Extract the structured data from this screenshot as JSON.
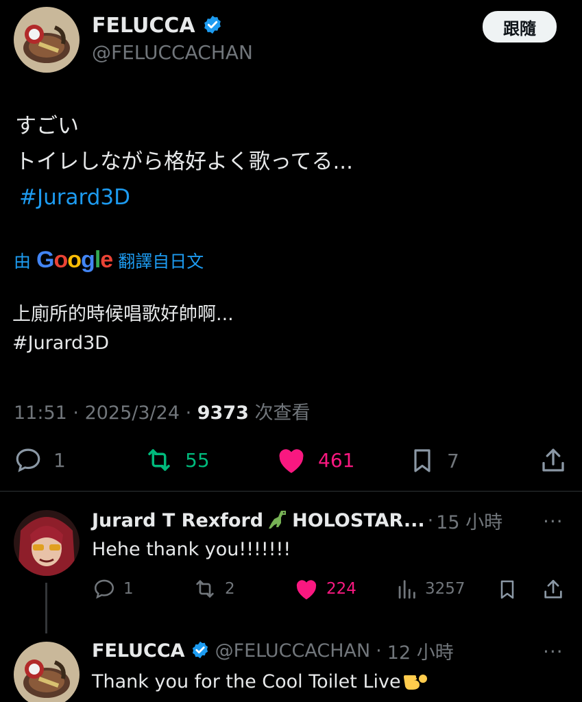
{
  "tweet": {
    "author_name": "FELUCCA",
    "author_handle": "@FELUCCACHAN",
    "follow_label": "跟隨",
    "text_line1": "すごい",
    "text_line2": "トイレしながら格好よく歌ってる...",
    "hashtag": "#Jurard3D",
    "translate_prefix": "由",
    "translate_brand": "Google",
    "translate_suffix": "翻譯自日文",
    "translated_text": "上廁所的時候唱歌好帥啊...",
    "translated_hashtag": "#Jurard3D",
    "time": "11:51",
    "date": "2025/3/24",
    "views": "9373",
    "views_suffix": "次查看",
    "stats": {
      "replies": "1",
      "retweets": "55",
      "likes": "461",
      "bookmarks": "7"
    }
  },
  "replies": [
    {
      "name": "Jurard T Rexford",
      "name_suffix": "HOLOSTAR...",
      "time": "15 小時",
      "text": "Hehe thank you!!!!!!!",
      "stats": {
        "replies": "1",
        "retweets": "2",
        "likes": "224",
        "views": "3257"
      }
    },
    {
      "name": "FELUCCA",
      "handle": "@FELUCCACHAN",
      "time": "12 小時",
      "text": "Thank you for the Cool Toilet Live"
    }
  ],
  "colors": {
    "accent": "#1d9bf0",
    "retweet": "#00ba7c",
    "like": "#f91880",
    "muted": "#71767b"
  },
  "icons": [
    "verified-badge-icon",
    "reply-icon",
    "retweet-icon",
    "heart-icon",
    "bookmark-icon",
    "share-icon",
    "views-icon",
    "more-icon",
    "dinosaur-emoji",
    "pointing-hand-emoji"
  ]
}
